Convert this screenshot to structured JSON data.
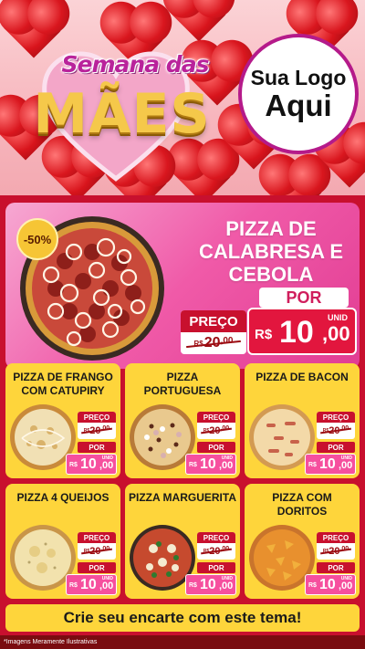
{
  "header": {
    "title_small": "Semana das",
    "title_big": "MÃES",
    "logo_line1": "Sua Logo",
    "logo_line2": "Aqui"
  },
  "feature": {
    "discount": "-50%",
    "name": "PIZZA DE CALABRESA E CEBOLA",
    "por": "POR",
    "preco_label": "PREÇO",
    "old_rs": "R$",
    "old_int": "20",
    "old_cents": ",00",
    "unid": "UNID",
    "price_rs": "R$",
    "price_int": "10",
    "price_cents": ",00"
  },
  "products": [
    {
      "name": "PIZZA DE FRANGO COM CATUPIRY",
      "preco": "PREÇO",
      "old_rs": "R$",
      "old_int": "20",
      "old_cents": ",00",
      "por": "POR",
      "unid": "UNID",
      "rs": "R$",
      "int": "10",
      "cents": ",00"
    },
    {
      "name": "PIZZA PORTUGUESA",
      "preco": "PREÇO",
      "old_rs": "R$",
      "old_int": "20",
      "old_cents": ",00",
      "por": "POR",
      "unid": "UNID",
      "rs": "R$",
      "int": "10",
      "cents": ",00"
    },
    {
      "name": "PIZZA DE BACON",
      "preco": "PREÇO",
      "old_rs": "R$",
      "old_int": "20",
      "old_cents": ",00",
      "por": "POR",
      "unid": "UNID",
      "rs": "R$",
      "int": "10",
      "cents": ",00"
    },
    {
      "name": "PIZZA 4 QUEIJOS",
      "preco": "PREÇO",
      "old_rs": "R$",
      "old_int": "20",
      "old_cents": ",00",
      "por": "POR",
      "unid": "UNID",
      "rs": "R$",
      "int": "10",
      "cents": ",00"
    },
    {
      "name": "PIZZA MARGUERITA",
      "preco": "PREÇO",
      "old_rs": "R$",
      "old_int": "20",
      "old_cents": ",00",
      "por": "POR",
      "unid": "UNID",
      "rs": "R$",
      "int": "10",
      "cents": ",00"
    },
    {
      "name": "PIZZA COM DORITOS",
      "preco": "PREÇO",
      "old_rs": "R$",
      "old_int": "20",
      "old_cents": ",00",
      "por": "POR",
      "unid": "UNID",
      "rs": "R$",
      "int": "10",
      "cents": ",00"
    }
  ],
  "cta": "Crie seu encarte com este tema!",
  "footer_note": "*Imagens Meramente Ilustrativas",
  "colors": {
    "brand_red": "#c8102e",
    "card_yellow": "#fed53b",
    "feature_pink": "#f05aa8",
    "price_pink": "#f64f9e"
  }
}
